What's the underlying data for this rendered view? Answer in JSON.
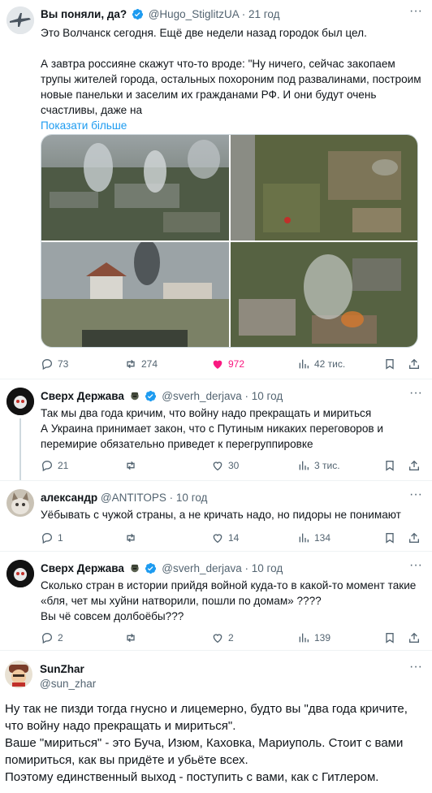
{
  "tweets": [
    {
      "name": "Вы поняли, да?",
      "handle": "@Hugo_StiglitzUA",
      "sep": "·",
      "time": "21 год",
      "paragraph1": "Это Волчанск сегодня. Ещё две недели назад городок был цел.",
      "paragraph2": "А завтра россияне скажут что-то вроде: \"Ну ничего, сейчас закопаем трупы жителей города, остальных похороним под развалинами, построим новые панельки и заселим их гражданами РФ. И они будут очень счастливы, даже на",
      "show_more": "Показати більше",
      "replies": "73",
      "retweets": "274",
      "likes": "972",
      "views": "42 тис."
    },
    {
      "name": "Сверх Держава",
      "handle": "@sverh_derjava",
      "sep": "·",
      "time": "10 год",
      "text": "Так мы два года кричим, что войну надо прекращать и мириться\nА Украина принимает закон, что с Путиным никаких переговоров и перемирие обязательно приведет к перегруппировке",
      "replies": "21",
      "retweets": "",
      "likes": "30",
      "views": "3 тис."
    },
    {
      "name": "александр",
      "handle": "@ANTITOPS",
      "sep": "·",
      "time": "10 год",
      "text": "Уёбывать с чужой страны, а не кричать надо, но пидоры не понимают",
      "replies": "1",
      "retweets": "",
      "likes": "14",
      "views": "134"
    },
    {
      "name": "Сверх Держава",
      "handle": "@sverh_derjava",
      "sep": "·",
      "time": "10 год",
      "text": "Сколько стран в истории прийдя войной куда-то в какой-то момент такие «бля, чет мы хуйни натворили, пошли по домам» ????\nВы чё совсем долбоёбы???",
      "replies": "2",
      "retweets": "",
      "likes": "2",
      "views": "139"
    },
    {
      "name": "SunZhar",
      "handle": "@sun_zhar",
      "text": "Ну так не пизди тогда гнусно и лицемерно, будто вы \"два года кричите, что войну надо прекращать и мириться\".\nВаше \"мириться\" - это Буча, Изюм, Каховка, Мариуполь. Стоит с вами помириться, как вы придёте и убьёте всех.\nПоэтому единственный выход - поступить с вами, как с Гитлером."
    }
  ],
  "colors": {
    "accent": "#1d9bf0",
    "like": "#f91880",
    "muted": "#536471"
  }
}
